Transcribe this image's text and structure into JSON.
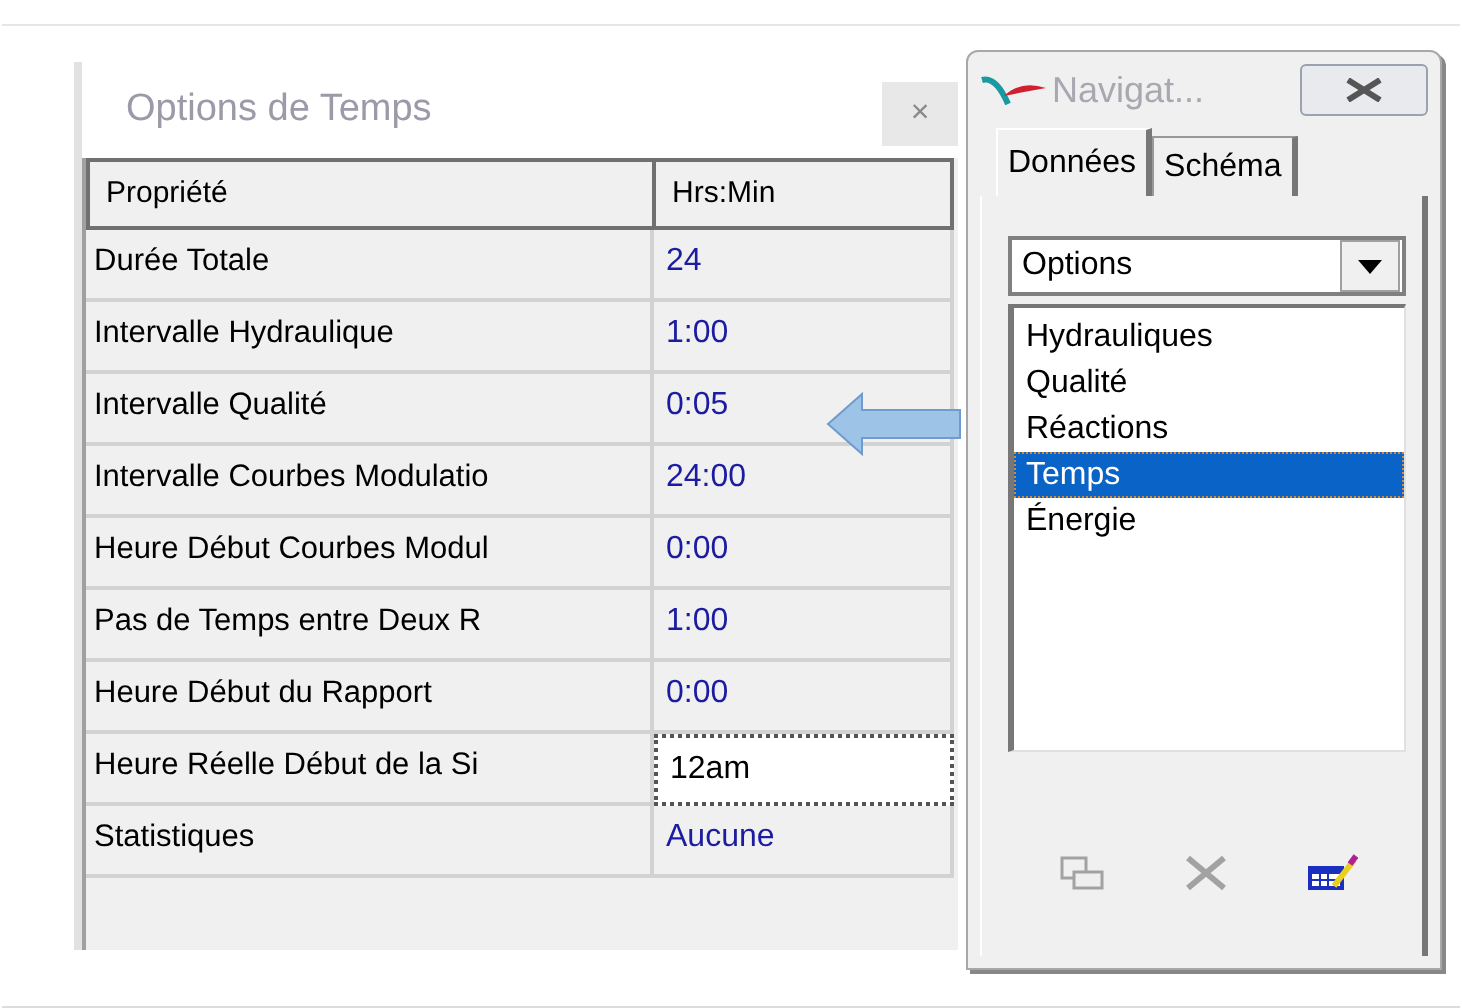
{
  "options_window": {
    "title": "Options de Temps",
    "close": "×",
    "columns": [
      "Propriété",
      "Hrs:Min"
    ],
    "rows": [
      {
        "property": "Durée Totale",
        "value": "24",
        "editing": false
      },
      {
        "property": "Intervalle Hydraulique",
        "value": "1:00",
        "editing": false
      },
      {
        "property": "Intervalle Qualité",
        "value": "0:05",
        "editing": false
      },
      {
        "property": "Intervalle Courbes Modulatio",
        "value": "24:00",
        "editing": false
      },
      {
        "property": "Heure Début Courbes Modul",
        "value": "0:00",
        "editing": false
      },
      {
        "property": "Pas de Temps entre Deux R",
        "value": "1:00",
        "editing": false
      },
      {
        "property": "Heure Début du Rapport",
        "value": "0:00",
        "editing": false
      },
      {
        "property": "Heure Réelle Début de la Si",
        "value": "12am",
        "editing": true
      },
      {
        "property": "Statistiques",
        "value": "Aucune",
        "editing": false
      }
    ]
  },
  "navigator": {
    "title": "Navigat...",
    "tabs": [
      {
        "label": "Données",
        "selected": true
      },
      {
        "label": "Schéma",
        "selected": false
      }
    ],
    "dropdown": {
      "value": "Options"
    },
    "items": [
      {
        "label": "Hydrauliques",
        "selected": false
      },
      {
        "label": "Qualité",
        "selected": false
      },
      {
        "label": "Réactions",
        "selected": false
      },
      {
        "label": "Temps",
        "selected": true
      },
      {
        "label": "Énergie",
        "selected": false
      }
    ],
    "toolbar": [
      {
        "kind": "copy",
        "disabled": true
      },
      {
        "kind": "delete",
        "disabled": true
      },
      {
        "kind": "edit",
        "disabled": false
      }
    ]
  }
}
